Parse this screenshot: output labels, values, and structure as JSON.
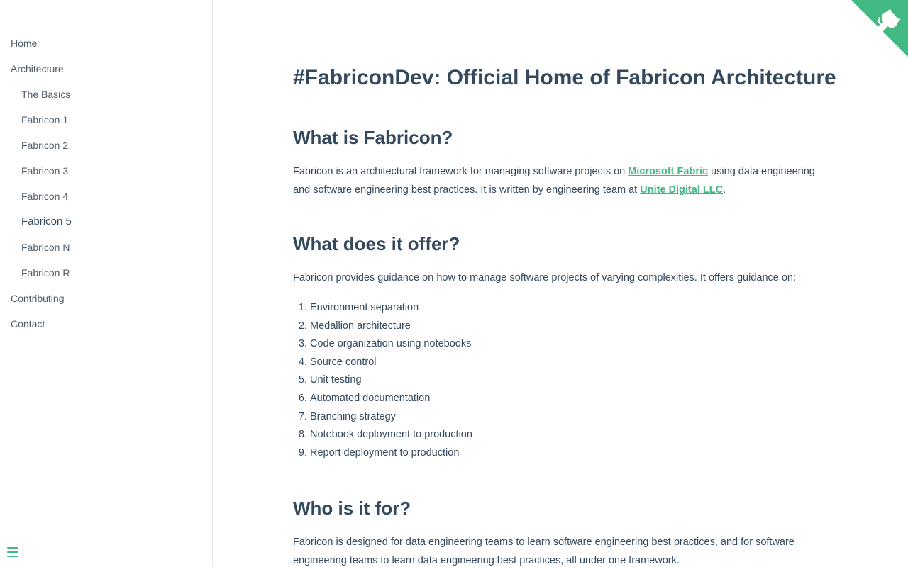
{
  "sidebar": {
    "items": [
      {
        "label": "Home"
      },
      {
        "label": "Architecture"
      },
      {
        "label": "The Basics"
      },
      {
        "label": "Fabricon 1"
      },
      {
        "label": "Fabricon 2"
      },
      {
        "label": "Fabricon 3"
      },
      {
        "label": "Fabricon 4"
      },
      {
        "label": "Fabricon 5"
      },
      {
        "label": "Fabricon N"
      },
      {
        "label": "Fabricon R"
      },
      {
        "label": "Contributing"
      },
      {
        "label": "Contact"
      }
    ],
    "active": "Fabricon 5",
    "toggle_icon": "menu-icon"
  },
  "corner": {
    "icon": "github-octocat-icon",
    "color": "#42b983"
  },
  "colors": {
    "accent": "#42b983",
    "text": "#34495e"
  },
  "main": {
    "title": "#FabriconDev: Official Home of Fabricon Architecture",
    "section1": {
      "heading": "What is Fabricon?",
      "text_before": "Fabricon is an architectural framework for managing software projects on ",
      "link1": "Microsoft Fabric",
      "text_middle": " using data engineering and software engineering best practices. It is written by engineering team at ",
      "link2": "Unite Digital LLC",
      "text_after": "."
    },
    "section2": {
      "heading": "What does it offer?",
      "intro": "Fabricon provides guidance on how to manage software projects of varying complexities. It offers guidance on:",
      "list": [
        {
          "num": "1.",
          "text": "Environment separation"
        },
        {
          "num": "2.",
          "text": "Medallion architecture"
        },
        {
          "num": "3.",
          "text": "Code organization using notebooks"
        },
        {
          "num": "4.",
          "text": "Source control"
        },
        {
          "num": "5.",
          "text": "Unit testing"
        },
        {
          "num": "6.",
          "text": "Automated documentation"
        },
        {
          "num": "7.",
          "text": "Branching strategy"
        },
        {
          "num": "8.",
          "text": "Notebook deployment to production"
        },
        {
          "num": "9.",
          "text": "Report deployment to production"
        }
      ]
    },
    "section3": {
      "heading": "Who is it for?",
      "text": "Fabricon is designed for data engineering teams to learn software engineering best practices, and for software engineering teams to learn data engineering best practices, all under one framework."
    }
  }
}
